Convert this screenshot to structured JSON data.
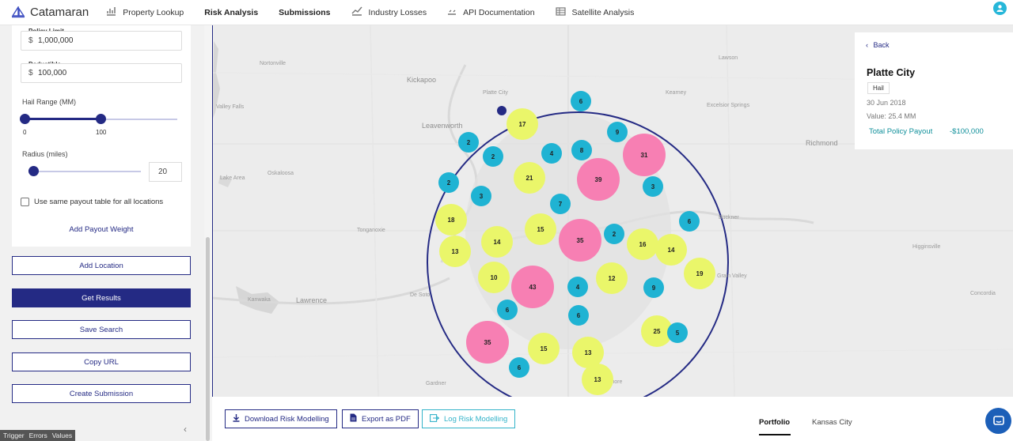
{
  "nav": {
    "brand": "Catamaran",
    "items": [
      {
        "label": "Property Lookup",
        "icon": "bar-chart-icon"
      },
      {
        "label": "Risk Analysis",
        "icon": ""
      },
      {
        "label": "Submissions",
        "icon": ""
      },
      {
        "label": "Industry Losses",
        "icon": "line-chart-icon"
      },
      {
        "label": "API Documentation",
        "icon": "code-icon"
      },
      {
        "label": "Satellite Analysis",
        "icon": "table-icon"
      }
    ]
  },
  "form": {
    "policy_limit_label": "Policy Limit",
    "policy_limit_currency": "$",
    "policy_limit_value": "1,000,000",
    "deductible_label": "Deductible",
    "deductible_currency": "$",
    "deductible_value": "100,000",
    "hail_range_label": "Hail Range (MM)",
    "hail_range_min": "0",
    "hail_range_max": "100",
    "radius_label": "Radius (miles)",
    "radius_value": "20",
    "same_payout_label": "Use same payout table for all locations",
    "add_payout_weight": "Add Payout Weight"
  },
  "actions": {
    "add_location": "Add Location",
    "get_results": "Get Results",
    "save_search": "Save Search",
    "copy_url": "Copy URL",
    "create_submission": "Create Submission"
  },
  "debug": {
    "trigger": "Trigger",
    "errors": "Errors",
    "values": "Values"
  },
  "map": {
    "towns": [
      "Nortonville",
      "Kickapoo",
      "Platte City",
      "Lawson",
      "Kearney",
      "Excelsior Springs",
      "Valley Falls",
      "Leavenworth",
      "Richmond",
      "Oskaloosa",
      "Lake Area",
      "Tonganoxie",
      "Buckner",
      "Higginsville",
      "Grain Valley",
      "De Soto",
      "Lawrence",
      "Kanwaka",
      "Concordia",
      "Gardner",
      "Raymore"
    ],
    "clusters": [
      {
        "label": "6",
        "kind": "cyan"
      },
      {
        "label": "17",
        "kind": "yellow"
      },
      {
        "label": "9",
        "kind": "cyan"
      },
      {
        "label": "2",
        "kind": "cyan"
      },
      {
        "label": "2",
        "kind": "cyan"
      },
      {
        "label": "4",
        "kind": "cyan"
      },
      {
        "label": "8",
        "kind": "cyan"
      },
      {
        "label": "31",
        "kind": "pink"
      },
      {
        "label": "21",
        "kind": "yellow"
      },
      {
        "label": "39",
        "kind": "pink"
      },
      {
        "label": "2",
        "kind": "cyan"
      },
      {
        "label": "3",
        "kind": "cyan"
      },
      {
        "label": "3",
        "kind": "cyan"
      },
      {
        "label": "7",
        "kind": "cyan"
      },
      {
        "label": "18",
        "kind": "yellow"
      },
      {
        "label": "15",
        "kind": "yellow"
      },
      {
        "label": "6",
        "kind": "cyan"
      },
      {
        "label": "14",
        "kind": "yellow"
      },
      {
        "label": "35",
        "kind": "pink"
      },
      {
        "label": "2",
        "kind": "cyan"
      },
      {
        "label": "16",
        "kind": "yellow"
      },
      {
        "label": "14",
        "kind": "yellow"
      },
      {
        "label": "13",
        "kind": "yellow"
      },
      {
        "label": "19",
        "kind": "yellow"
      },
      {
        "label": "10",
        "kind": "yellow"
      },
      {
        "label": "43",
        "kind": "pink"
      },
      {
        "label": "4",
        "kind": "cyan"
      },
      {
        "label": "12",
        "kind": "yellow"
      },
      {
        "label": "9",
        "kind": "cyan"
      },
      {
        "label": "6",
        "kind": "cyan"
      },
      {
        "label": "6",
        "kind": "cyan"
      },
      {
        "label": "25",
        "kind": "yellow"
      },
      {
        "label": "5",
        "kind": "cyan"
      },
      {
        "label": "35",
        "kind": "pink"
      },
      {
        "label": "15",
        "kind": "yellow"
      },
      {
        "label": "13",
        "kind": "yellow"
      },
      {
        "label": "6",
        "kind": "cyan"
      },
      {
        "label": "13",
        "kind": "yellow"
      }
    ],
    "colors": {
      "cyan": "#1fb3d3",
      "yellow": "#eaf66a",
      "pink": "#f77fb3",
      "radius": "#242a84"
    }
  },
  "card": {
    "back": "Back",
    "title": "Platte City",
    "peril": "Hail",
    "date": "30 Jun 2018",
    "value": "Value: 25.4 MM",
    "payout_label": "Total Policy Payout",
    "payout_value": "-$100,000"
  },
  "bottom": {
    "download": "Download Risk Modelling",
    "export_pdf": "Export as PDF",
    "log": "Log Risk Modelling",
    "tabs": [
      "Portfolio",
      "Kansas City"
    ]
  }
}
